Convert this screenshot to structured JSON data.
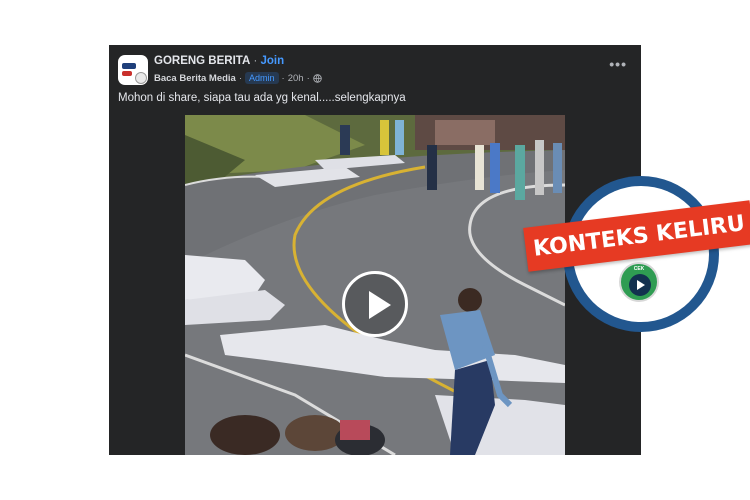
{
  "post": {
    "page_name": "GORENG BERITA",
    "separator": " · ",
    "join_label": "Join",
    "author": "Baca Berita Media",
    "role_badge": "Admin",
    "time": "20h",
    "time_separator": "·",
    "privacy_icon": "globe-icon",
    "more_icon": "more-options-icon",
    "more_label": "•••",
    "text": "Mohon di share, siapa tau ada yg kenal.....selengkapnya"
  },
  "video": {
    "play_icon": "play-icon"
  },
  "stamp": {
    "label": "KONTEKS KELIRU",
    "logo_text": "CEK",
    "colors": {
      "banner": "#e63a23",
      "ring": "#22578f",
      "logo": "#2f9c52"
    }
  },
  "colors": {
    "card_background": "#242526",
    "text_primary": "#e4e6eb",
    "text_secondary": "#b0b3b8",
    "link": "#4599ff"
  }
}
